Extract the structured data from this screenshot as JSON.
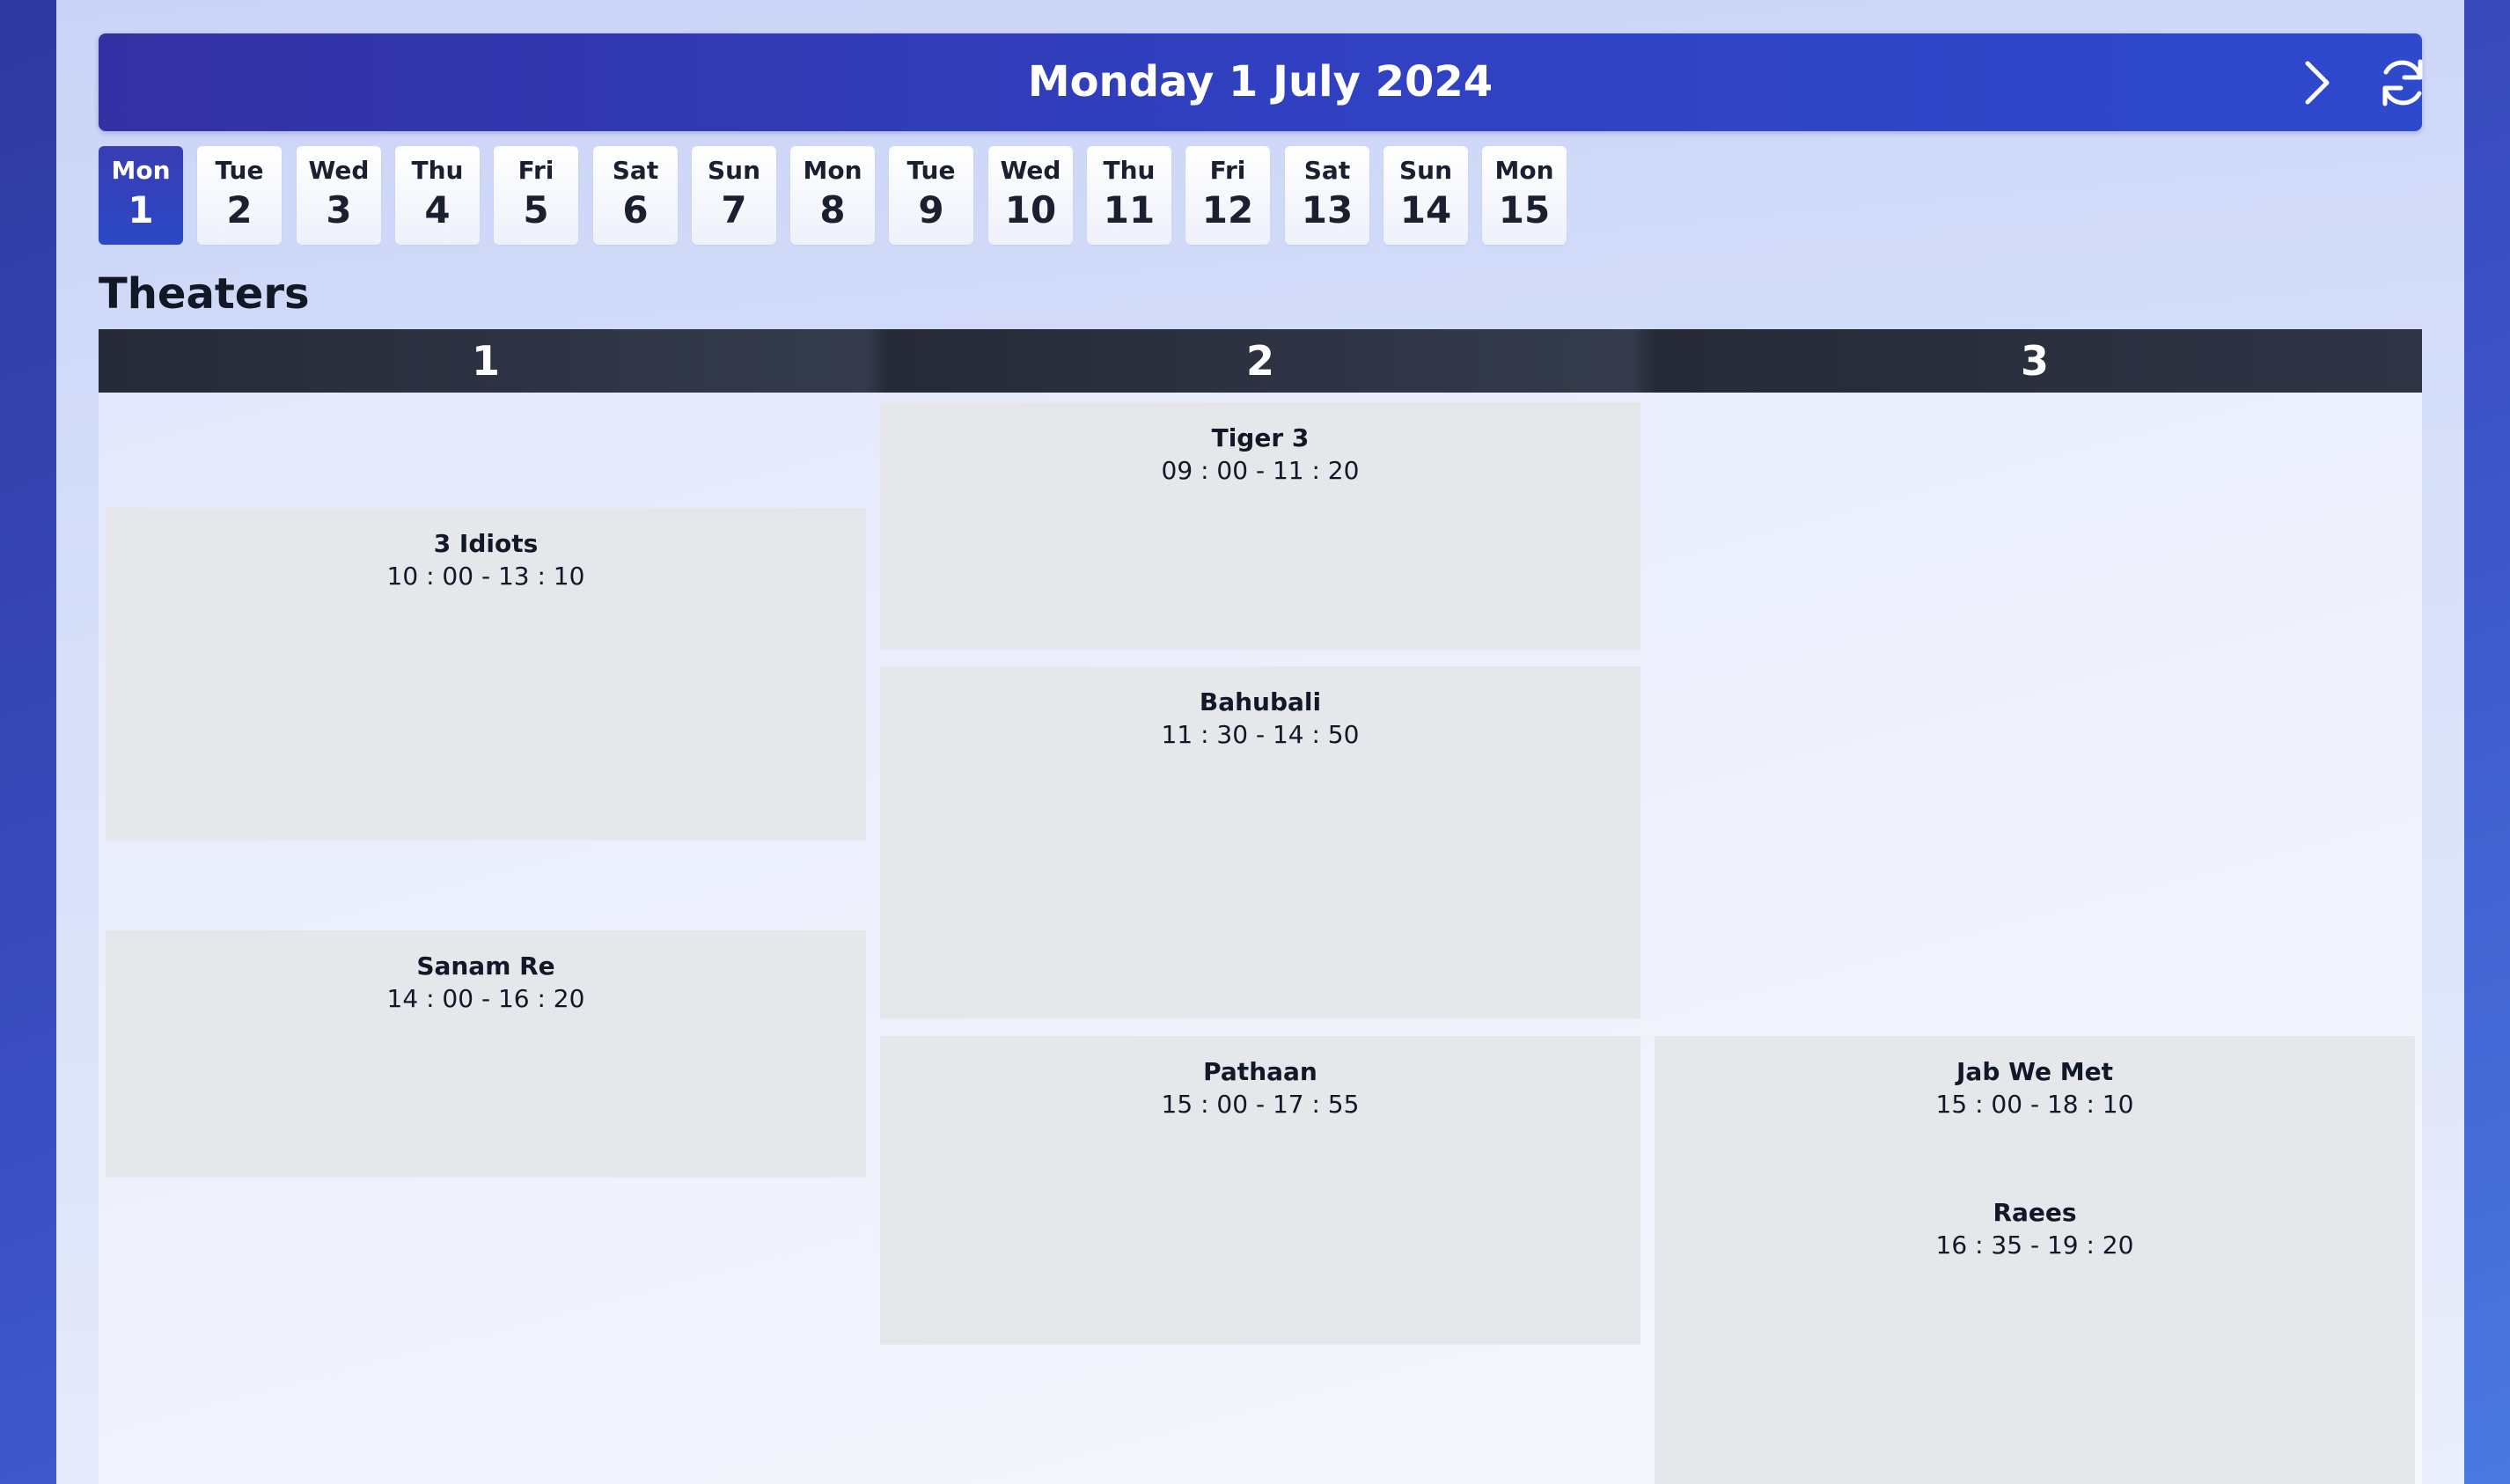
{
  "header": {
    "date_title": "Monday 1 July 2024"
  },
  "icons": {
    "next": "chevron-right-icon",
    "refresh": "refresh-icon"
  },
  "days": [
    {
      "dow": "Mon",
      "num": "1",
      "active": true
    },
    {
      "dow": "Tue",
      "num": "2"
    },
    {
      "dow": "Wed",
      "num": "3"
    },
    {
      "dow": "Thu",
      "num": "4"
    },
    {
      "dow": "Fri",
      "num": "5"
    },
    {
      "dow": "Sat",
      "num": "6"
    },
    {
      "dow": "Sun",
      "num": "7"
    },
    {
      "dow": "Mon",
      "num": "8"
    },
    {
      "dow": "Tue",
      "num": "9"
    },
    {
      "dow": "Wed",
      "num": "10"
    },
    {
      "dow": "Thu",
      "num": "11"
    },
    {
      "dow": "Fri",
      "num": "12"
    },
    {
      "dow": "Sat",
      "num": "13"
    },
    {
      "dow": "Sun",
      "num": "14"
    },
    {
      "dow": "Mon",
      "num": "15"
    }
  ],
  "section_title": "Theaters",
  "theaters": [
    {
      "label": "1",
      "shows": [
        {
          "title": "3 Idiots",
          "time": "10 : 00 - 13 : 10"
        },
        {
          "title": "Sanam Re",
          "time": "14 : 00 - 16 : 20"
        }
      ]
    },
    {
      "label": "2",
      "shows": [
        {
          "title": "Tiger 3",
          "time": "09 : 00 - 11 : 20"
        },
        {
          "title": "Bahubali",
          "time": "11 : 30 - 14 : 50"
        },
        {
          "title": "Pathaan",
          "time": "15 : 00 - 17 : 55"
        }
      ]
    },
    {
      "label": "3",
      "shows": [
        {
          "title": "Jab We Met",
          "time": "15 : 00 - 18 : 10"
        },
        {
          "title": "Raees",
          "time": "16 : 35 - 19 : 20"
        }
      ]
    }
  ],
  "colors": {
    "accent": "#2f49cc",
    "header_dark": "#252a37",
    "show_bg": "#e5e7eb"
  }
}
